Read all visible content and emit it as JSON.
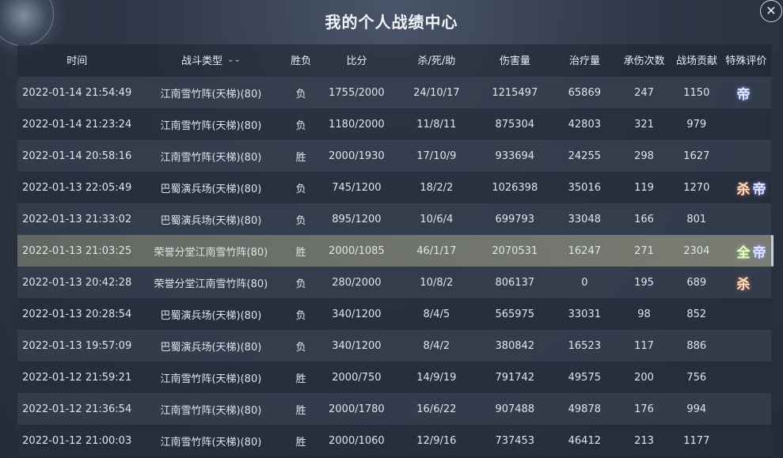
{
  "title": "我的个人战绩中心",
  "close_label": "✕",
  "columns": {
    "time": "时间",
    "type": "战斗类型",
    "result": "胜负",
    "score": "比分",
    "kda": "杀/死/助",
    "damage": "伤害量",
    "healing": "治疗量",
    "hits_taken": "承伤次数",
    "contribution": "战场贡献",
    "evaluation": "特殊评价"
  },
  "sort_icon": "chevron-down-icon",
  "rows": [
    {
      "time": "2022-01-14 21:54:49",
      "type": "江南雪竹阵(天梯)(80)",
      "result": "负",
      "score": "1755/2000",
      "kda": "24/10/17",
      "damage": "1215497",
      "healing": "65869",
      "hits_taken": "247",
      "contribution": "1150",
      "badges": [
        "帝"
      ]
    },
    {
      "time": "2022-01-14 21:23:24",
      "type": "江南雪竹阵(天梯)(80)",
      "result": "负",
      "score": "1180/2000",
      "kda": "11/8/11",
      "damage": "875304",
      "healing": "42803",
      "hits_taken": "321",
      "contribution": "979",
      "badges": []
    },
    {
      "time": "2022-01-14 20:58:16",
      "type": "江南雪竹阵(天梯)(80)",
      "result": "胜",
      "score": "2000/1930",
      "kda": "17/10/9",
      "damage": "933694",
      "healing": "24255",
      "hits_taken": "298",
      "contribution": "1627",
      "badges": []
    },
    {
      "time": "2022-01-13 22:05:49",
      "type": "巴蜀演兵场(天梯)(80)",
      "result": "负",
      "score": "745/1200",
      "kda": "18/2/2",
      "damage": "1026398",
      "healing": "35016",
      "hits_taken": "119",
      "contribution": "1270",
      "badges": [
        "杀",
        "帝"
      ]
    },
    {
      "time": "2022-01-13 21:33:02",
      "type": "巴蜀演兵场(天梯)(80)",
      "result": "负",
      "score": "895/1200",
      "kda": "10/6/4",
      "damage": "699793",
      "healing": "33048",
      "hits_taken": "166",
      "contribution": "801",
      "badges": []
    },
    {
      "time": "2022-01-13 21:03:25",
      "type": "荣誉分堂江南雪竹阵(80)",
      "result": "胜",
      "score": "2000/1085",
      "kda": "46/1/17",
      "damage": "2070531",
      "healing": "16247",
      "hits_taken": "271",
      "contribution": "2304",
      "badges": [
        "全",
        "帝"
      ],
      "highlight": true
    },
    {
      "time": "2022-01-13 20:42:28",
      "type": "荣誉分堂江南雪竹阵(80)",
      "result": "负",
      "score": "280/2000",
      "kda": "10/8/2",
      "damage": "806137",
      "healing": "0",
      "hits_taken": "195",
      "contribution": "689",
      "badges": [
        "杀"
      ]
    },
    {
      "time": "2022-01-13 20:28:54",
      "type": "巴蜀演兵场(天梯)(80)",
      "result": "负",
      "score": "340/1200",
      "kda": "8/4/5",
      "damage": "565975",
      "healing": "33031",
      "hits_taken": "98",
      "contribution": "852",
      "badges": []
    },
    {
      "time": "2022-01-13 19:57:09",
      "type": "巴蜀演兵场(天梯)(80)",
      "result": "负",
      "score": "340/1200",
      "kda": "8/4/2",
      "damage": "380842",
      "healing": "16523",
      "hits_taken": "117",
      "contribution": "886",
      "badges": []
    },
    {
      "time": "2022-01-12 21:59:21",
      "type": "江南雪竹阵(天梯)(80)",
      "result": "胜",
      "score": "2000/750",
      "kda": "14/9/19",
      "damage": "791742",
      "healing": "49575",
      "hits_taken": "200",
      "contribution": "756",
      "badges": []
    },
    {
      "time": "2022-01-12 21:36:54",
      "type": "江南雪竹阵(天梯)(80)",
      "result": "胜",
      "score": "2000/1780",
      "kda": "16/6/22",
      "damage": "907488",
      "healing": "49878",
      "hits_taken": "176",
      "contribution": "994",
      "badges": []
    },
    {
      "time": "2022-01-12 21:00:03",
      "type": "江南雪竹阵(天梯)(80)",
      "result": "胜",
      "score": "2000/1060",
      "kda": "12/9/16",
      "damage": "737453",
      "healing": "46412",
      "hits_taken": "213",
      "contribution": "1177",
      "badges": []
    }
  ]
}
